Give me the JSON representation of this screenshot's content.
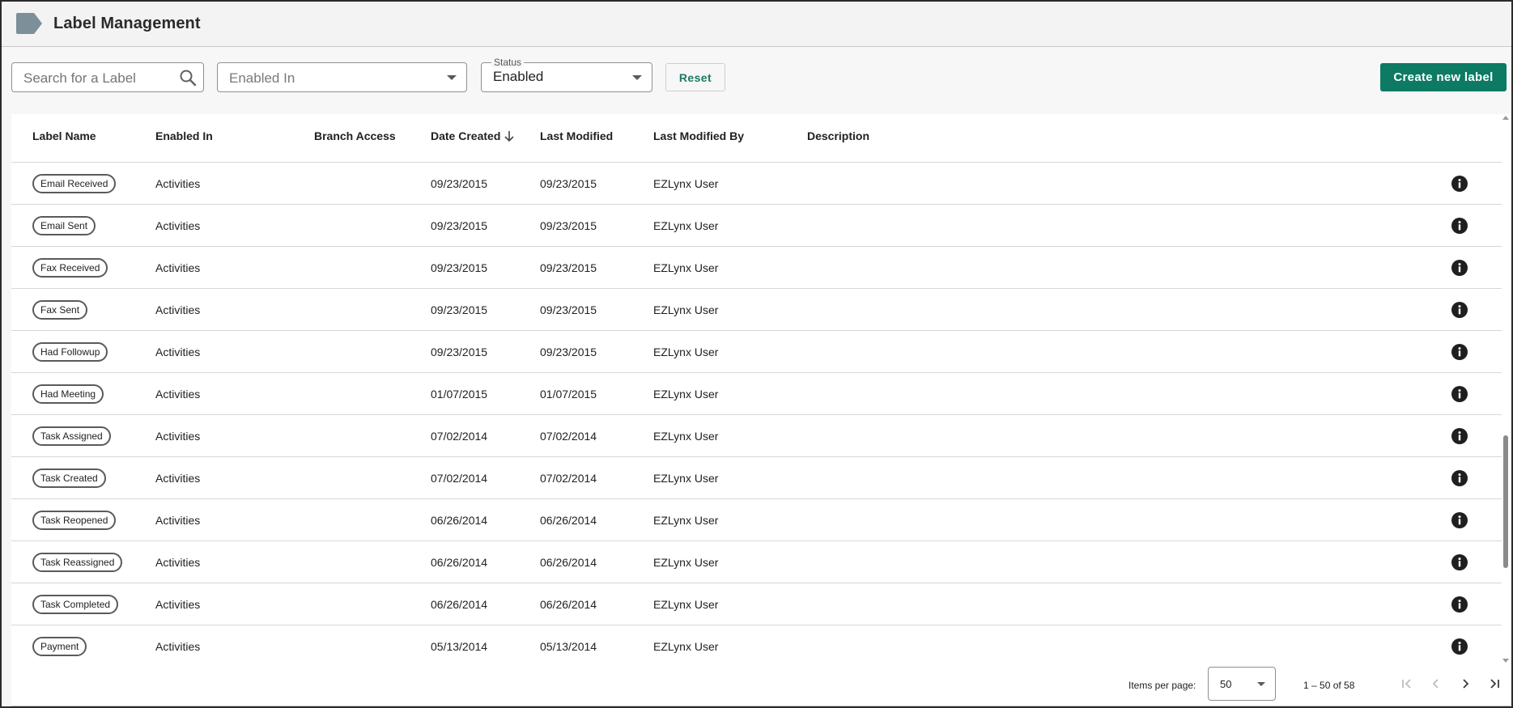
{
  "header": {
    "title": "Label Management"
  },
  "toolbar": {
    "search_placeholder": "Search for a Label",
    "enabled_in_placeholder": "Enabled In",
    "status_label": "Status",
    "status_value": "Enabled",
    "reset_label": "Reset",
    "create_label": "Create new label"
  },
  "table": {
    "columns": [
      "Label Name",
      "Enabled In",
      "Branch Access",
      "Date Created",
      "Last Modified",
      "Last Modified By",
      "Description"
    ],
    "sorted_column": "Date Created",
    "sort_direction": "descending",
    "rows": [
      {
        "label": "Email Received",
        "enabled_in": "Activities",
        "branch_access": "",
        "date_created": "09/23/2015",
        "last_modified": "09/23/2015",
        "modified_by": "EZLynx User",
        "description": ""
      },
      {
        "label": "Email Sent",
        "enabled_in": "Activities",
        "branch_access": "",
        "date_created": "09/23/2015",
        "last_modified": "09/23/2015",
        "modified_by": "EZLynx User",
        "description": ""
      },
      {
        "label": "Fax Received",
        "enabled_in": "Activities",
        "branch_access": "",
        "date_created": "09/23/2015",
        "last_modified": "09/23/2015",
        "modified_by": "EZLynx User",
        "description": ""
      },
      {
        "label": "Fax Sent",
        "enabled_in": "Activities",
        "branch_access": "",
        "date_created": "09/23/2015",
        "last_modified": "09/23/2015",
        "modified_by": "EZLynx User",
        "description": ""
      },
      {
        "label": "Had Followup",
        "enabled_in": "Activities",
        "branch_access": "",
        "date_created": "09/23/2015",
        "last_modified": "09/23/2015",
        "modified_by": "EZLynx User",
        "description": ""
      },
      {
        "label": "Had Meeting",
        "enabled_in": "Activities",
        "branch_access": "",
        "date_created": "01/07/2015",
        "last_modified": "01/07/2015",
        "modified_by": "EZLynx User",
        "description": ""
      },
      {
        "label": "Task Assigned",
        "enabled_in": "Activities",
        "branch_access": "",
        "date_created": "07/02/2014",
        "last_modified": "07/02/2014",
        "modified_by": "EZLynx User",
        "description": ""
      },
      {
        "label": "Task Created",
        "enabled_in": "Activities",
        "branch_access": "",
        "date_created": "07/02/2014",
        "last_modified": "07/02/2014",
        "modified_by": "EZLynx User",
        "description": ""
      },
      {
        "label": "Task Reopened",
        "enabled_in": "Activities",
        "branch_access": "",
        "date_created": "06/26/2014",
        "last_modified": "06/26/2014",
        "modified_by": "EZLynx User",
        "description": ""
      },
      {
        "label": "Task Reassigned",
        "enabled_in": "Activities",
        "branch_access": "",
        "date_created": "06/26/2014",
        "last_modified": "06/26/2014",
        "modified_by": "EZLynx User",
        "description": ""
      },
      {
        "label": "Task Completed",
        "enabled_in": "Activities",
        "branch_access": "",
        "date_created": "06/26/2014",
        "last_modified": "06/26/2014",
        "modified_by": "EZLynx User",
        "description": ""
      },
      {
        "label": "Payment",
        "enabled_in": "Activities",
        "branch_access": "",
        "date_created": "05/13/2014",
        "last_modified": "05/13/2014",
        "modified_by": "EZLynx User",
        "description": ""
      }
    ]
  },
  "paginator": {
    "items_per_page_label": "Items per page:",
    "items_per_page_value": "50",
    "range_label": "1 – 50 of 58"
  },
  "colors": {
    "accent": "#0d7a63",
    "reset_text": "#1b7a63",
    "header_icon": "#7d8f98",
    "info_icon": "#1f1f1f"
  },
  "icons": {
    "header": "label-tag-icon",
    "search": "search-icon",
    "row_info": "info-icon",
    "sort": "arrow-down-icon"
  }
}
